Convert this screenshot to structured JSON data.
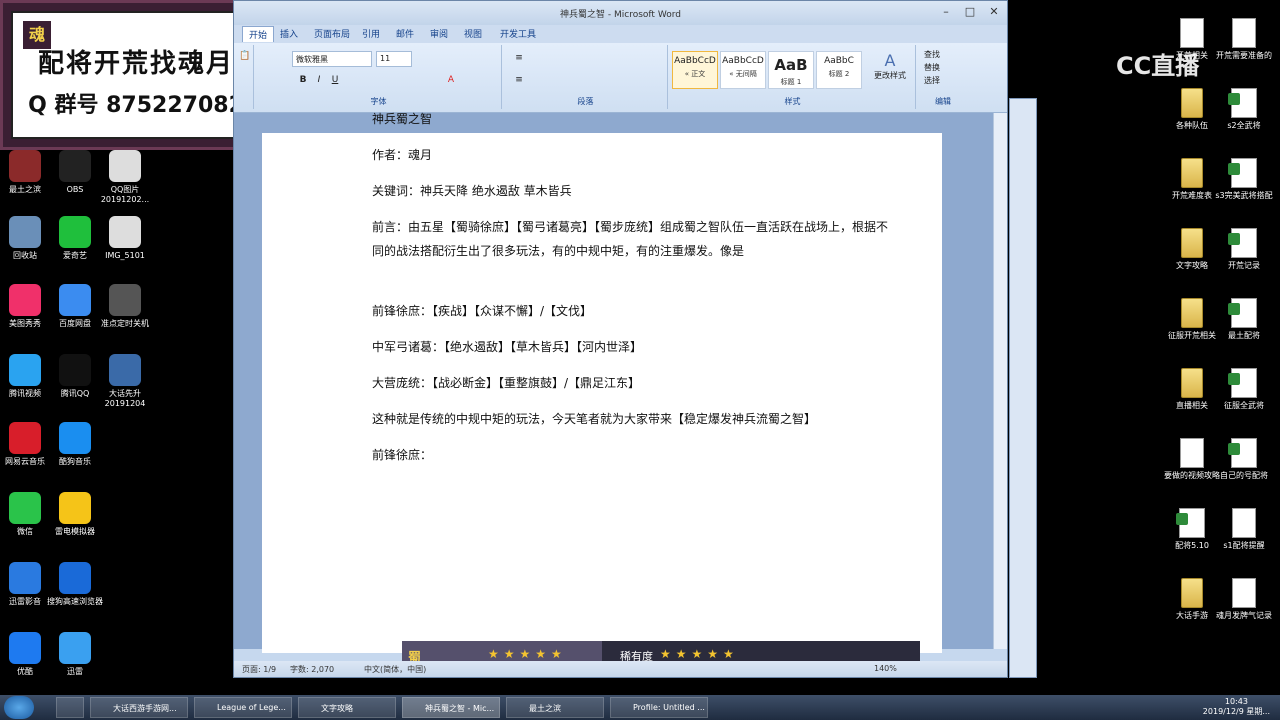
{
  "promo": {
    "line1": "配将开荒找魂月",
    "line2": "Q 群号 875227082",
    "badge": "魂"
  },
  "cc_logo": "CC直播",
  "word": {
    "title": "神兵蜀之智 - Microsoft Word",
    "tabs": [
      "开始",
      "插入",
      "页面布局",
      "引用",
      "邮件",
      "审阅",
      "视图",
      "开发工具"
    ],
    "font_name": "微软雅黑",
    "font_size": "11",
    "groups": {
      "font": "字体",
      "paragraph": "段落",
      "styles": "样式",
      "editing": "编辑"
    },
    "styles": [
      {
        "sample": "AaBbCcD",
        "name": "« 正文"
      },
      {
        "sample": "AaBbCcD",
        "name": "« 无间隔"
      },
      {
        "sample": "AaB",
        "name": "标题 1"
      },
      {
        "sample": "AaBbC",
        "name": "标题 2"
      }
    ],
    "change_style": "更改样式",
    "editing": [
      "查找",
      "替换",
      "选择"
    ],
    "doc": [
      "神兵蜀之智",
      "作者：魂月",
      "关键词：神兵天降 绝水遏敌 草木皆兵",
      "前言：由五星【蜀骑徐庶】【蜀弓诸葛亮】【蜀步庞统】组成蜀之智队伍一直活跃在战场上，根据不同的战法搭配衍生出了很多玩法，有的中规中矩，有的注重爆发。像是",
      "前锋徐庶：【疾战】【众谋不懈】/【文伐】",
      "中军弓诸葛：【绝水遏敌】【草木皆兵】【河内世泽】",
      "大营庞统：【战必断金】【重整旗鼓】/【鼎足江东】",
      "这种就是传统的中规中矩的玩法，今天笔者就为大家带来【稳定爆发神兵流蜀之智】",
      "前锋徐庶："
    ],
    "game_strip": {
      "label": "蜀",
      "rarity": "稀有度",
      "stars_left": "★★★★★",
      "stars_right": "★★★★★"
    },
    "status": {
      "page": "页面: 1/9",
      "words": "字数: 2,070",
      "lang": "中文(简体，中国)",
      "zoom": "140%"
    }
  },
  "desktop_left": [
    {
      "label": "最土之滨",
      "color": "#8b2a2a"
    },
    {
      "label": "OBS",
      "color": "#222"
    },
    {
      "label": "QQ图片20191202...",
      "color": "#ddd"
    },
    {
      "label": "回收站",
      "color": "#6a8fb8"
    },
    {
      "label": "爱奇艺",
      "color": "#1fbf3c"
    },
    {
      "label": "IMG_5101",
      "color": "#ddd"
    },
    {
      "label": "美图秀秀",
      "color": "#f0306a"
    },
    {
      "label": "百度网盘",
      "color": "#3b8cf0"
    },
    {
      "label": "准点定时关机",
      "color": "#555"
    },
    {
      "label": "腾讯视频",
      "color": "#2aa3f0"
    },
    {
      "label": "腾讯QQ",
      "color": "#111"
    },
    {
      "label": "大话先升20191204",
      "color": "#3a6aa8"
    },
    {
      "label": "网易云音乐",
      "color": "#d81e2a"
    },
    {
      "label": "酷狗音乐",
      "color": "#1a8ef0"
    },
    {
      "label": "微信",
      "color": "#2ac34a"
    },
    {
      "label": "雷电模拟器",
      "color": "#f5c418"
    },
    {
      "label": "迅雷影音",
      "color": "#2a7ae0"
    },
    {
      "label": "搜狗高速浏览器",
      "color": "#1a6ad8"
    },
    {
      "label": "优酷",
      "color": "#1e7af0"
    },
    {
      "label": "迅雷",
      "color": "#3aa0f0"
    }
  ],
  "desktop_right": [
    {
      "label": "开荒相关",
      "type": "doc"
    },
    {
      "label": "开荒需要准备的",
      "type": "doc"
    },
    {
      "label": "各种队伍",
      "type": "folder"
    },
    {
      "label": "s2全武将",
      "type": "xls"
    },
    {
      "label": "开荒难度表",
      "type": "folder"
    },
    {
      "label": "s3完美武将搭配",
      "type": "xls"
    },
    {
      "label": "文字攻略",
      "type": "folder"
    },
    {
      "label": "开荒记录",
      "type": "xls"
    },
    {
      "label": "征服开荒相关",
      "type": "folder"
    },
    {
      "label": "最土配将",
      "type": "xls"
    },
    {
      "label": "直播相关",
      "type": "folder"
    },
    {
      "label": "征服全武将",
      "type": "xls"
    },
    {
      "label": "要做的视频攻略",
      "type": "doc"
    },
    {
      "label": "自己的号配将",
      "type": "xls"
    },
    {
      "label": "配将5.10",
      "type": "xls"
    },
    {
      "label": "s1配将提醒",
      "type": "doc"
    },
    {
      "label": "大话手游",
      "type": "folder"
    },
    {
      "label": "魂月发牌气记录",
      "type": "doc"
    }
  ],
  "taskbar": [
    {
      "label": "",
      "w": 28
    },
    {
      "label": "大话西游手游网...",
      "w": 98
    },
    {
      "label": "League of Lege...",
      "w": 98
    },
    {
      "label": "文字攻略",
      "w": 98
    },
    {
      "label": "神兵蜀之智 - Mic...",
      "w": 98,
      "active": true
    },
    {
      "label": "最土之滨",
      "w": 98
    },
    {
      "label": "Profile: Untitled ...",
      "w": 98
    }
  ],
  "clock": {
    "time": "10:43",
    "date": "2019/12/9 星期..."
  }
}
